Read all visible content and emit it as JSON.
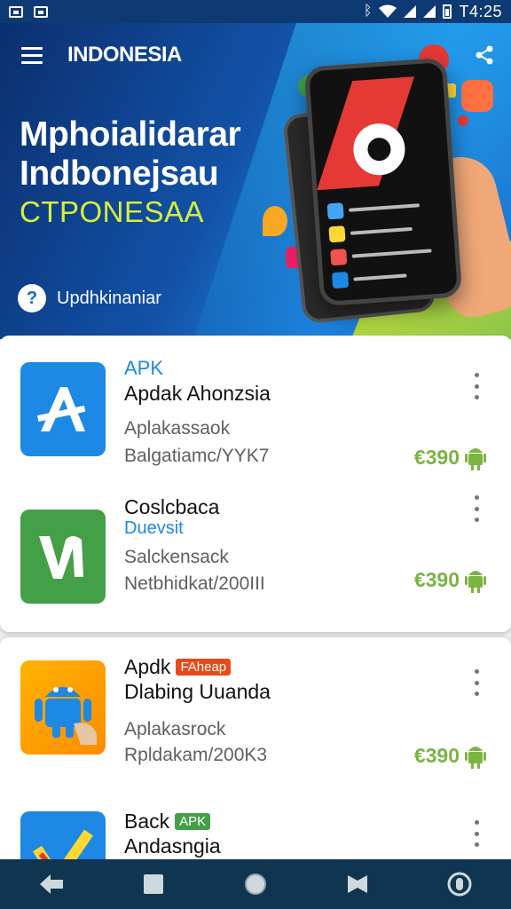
{
  "status_bar": {
    "time": "T4:25",
    "left_icons": [
      "gallery-icon",
      "photo-icon"
    ],
    "right_icons": [
      "bluetooth-icon",
      "wifi-icon",
      "signal-icon",
      "signal-icon",
      "battery-icon"
    ]
  },
  "header": {
    "menu_icon": "hamburger-menu-icon",
    "title": "INDONESIA",
    "share_icon": "share-icon"
  },
  "banner": {
    "title_line1": "Mphoialidarar",
    "title_line2": "Indbonejsau",
    "subtitle": "CTPONESAA",
    "update_icon_glyph": "?",
    "update_text": "Updhkinaniar"
  },
  "apps": [
    {
      "line1": "APK",
      "line2": "Apdak Ahonzsia",
      "line3": "Aplakassaok",
      "line4": "Balgatiamc/YYK7",
      "price": "€390",
      "icon": "app-store-a-icon",
      "icon_color": "#1e88e5"
    },
    {
      "line1": "Coslcbaca",
      "line2": "Duevsit",
      "line3": "Salckensack",
      "line4": "Netbhidkat/200III",
      "price": "€390",
      "icon": "vine-v-icon",
      "icon_color": "#43a047"
    },
    {
      "line1": "Apdk",
      "badge": "FAheap",
      "line2": "Dlabing Uuanda",
      "line3": "Aplakasrock",
      "line4": "Rpldakam/200K3",
      "price": "€390",
      "icon": "android-robot-icon",
      "icon_color": "#ffa000"
    },
    {
      "line1": "Back",
      "badge": "APK",
      "line2": "Andasngia",
      "icon": "checkmark-icon",
      "icon_color": "#1e88e5"
    }
  ],
  "colors": {
    "accent_blue": "#1e88e5",
    "price_green": "#7cb342",
    "badge_red": "#e64a19",
    "badge_green": "#43a047",
    "navbar": "#0f3550"
  },
  "navbar": {
    "icons": [
      "back-icon",
      "recent-apps-icon",
      "home-icon",
      "bookmark-icon",
      "assistant-icon"
    ]
  }
}
